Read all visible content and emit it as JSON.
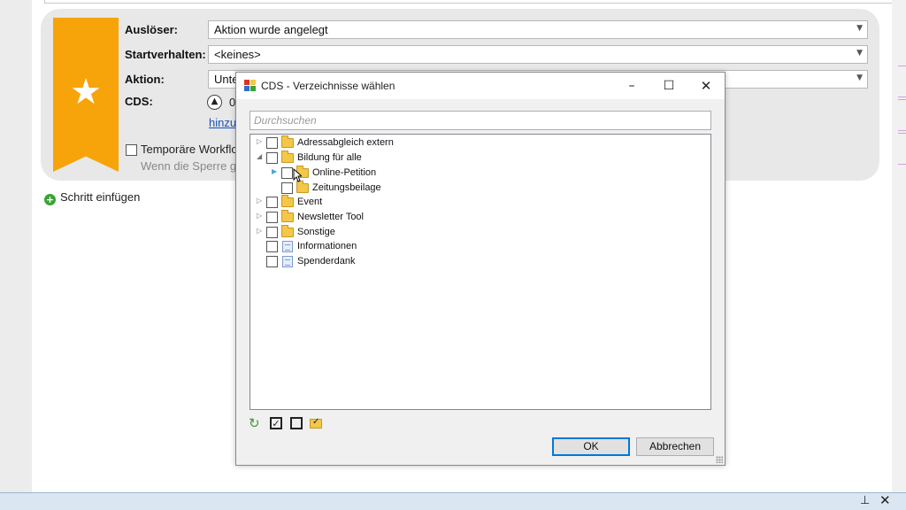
{
  "workflow": {
    "trigger_label": "Auslöser:",
    "trigger_value": "Aktion wurde angelegt",
    "start_label": "Startverhalten:",
    "start_value": "<keines>",
    "action_label": "Aktion:",
    "action_value": "Unte",
    "cds_label": "CDS:",
    "cds_value": "0",
    "add_link": "hinzu",
    "temp_label": "Temporäre Workflo",
    "temp_sub": "Wenn die Sperre g",
    "add_step": "Schritt einfügen"
  },
  "dialog": {
    "title": "CDS - Verzeichnisse wählen",
    "search_placeholder": "Durchsuchen",
    "tree": [
      {
        "label": "Adressabgleich extern",
        "type": "folder",
        "level": 0,
        "expander": "collapsed"
      },
      {
        "label": "Bildung für alle",
        "type": "folder",
        "level": 0,
        "expander": "expanded"
      },
      {
        "label": "Online-Petition",
        "type": "folder",
        "level": 1,
        "expander": "collapsed"
      },
      {
        "label": "Zeitungsbeilage",
        "type": "folder",
        "level": 1,
        "expander": "none"
      },
      {
        "label": "Event",
        "type": "folder",
        "level": 0,
        "expander": "collapsed"
      },
      {
        "label": "Newsletter Tool",
        "type": "folder",
        "level": 0,
        "expander": "collapsed"
      },
      {
        "label": "Sonstige",
        "type": "folder",
        "level": 0,
        "expander": "collapsed"
      },
      {
        "label": "Informationen",
        "type": "document",
        "level": 0,
        "expander": "none"
      },
      {
        "label": "Spenderdank",
        "type": "document",
        "level": 0,
        "expander": "none"
      }
    ],
    "ok_label": "OK",
    "cancel_label": "Abbrechen"
  },
  "colors": {
    "ribbon": "#f7a40a",
    "accent": "#0078d7",
    "folder": "#f3c748"
  },
  "icons": {
    "ribbon": "star-icon",
    "tree_folder": "folder-icon",
    "tree_document": "document-icon",
    "toolbar": [
      "refresh-icon",
      "check-all-icon",
      "uncheck-all-icon",
      "folder-check-icon"
    ]
  }
}
